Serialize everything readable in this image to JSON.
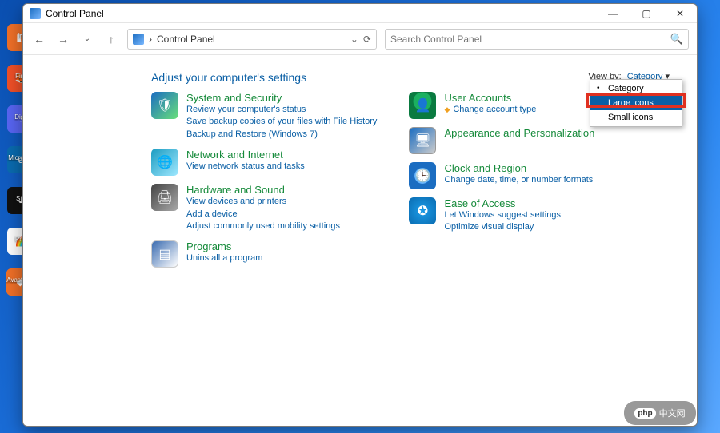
{
  "window": {
    "title": "Control Panel",
    "address": "Control Panel",
    "search_placeholder": "Search Control Panel"
  },
  "heading": "Adjust your computer's settings",
  "viewby": {
    "label": "View by:",
    "current": "Category"
  },
  "menu": {
    "items": [
      {
        "label": "Category",
        "bullet": true
      },
      {
        "label": "Large icons",
        "selected": true
      },
      {
        "label": "Small icons"
      }
    ]
  },
  "left_col": [
    {
      "title": "System and Security",
      "links": [
        "Review your computer's status",
        "Save backup copies of your files with File History",
        "Backup and Restore (Windows 7)"
      ]
    },
    {
      "title": "Network and Internet",
      "links": [
        "View network status and tasks"
      ]
    },
    {
      "title": "Hardware and Sound",
      "links": [
        "View devices and printers",
        "Add a device",
        "Adjust commonly used mobility settings"
      ]
    },
    {
      "title": "Programs",
      "links": [
        "Uninstall a program"
      ]
    }
  ],
  "right_col": [
    {
      "title": "User Accounts",
      "links": [
        "Change account type"
      ],
      "shield_on_first": true
    },
    {
      "title": "Appearance and Personalization",
      "links": []
    },
    {
      "title": "Clock and Region",
      "links": [
        "Change date, time, or number formats"
      ]
    },
    {
      "title": "Ease of Access",
      "links": [
        "Let Windows suggest settings",
        "Optimize visual display"
      ]
    }
  ],
  "desktop": [
    "In",
    "Fire",
    "Disc",
    "Micro Ed",
    "Ste",
    "Pho",
    "Avast Anti"
  ],
  "bug": "中文网"
}
